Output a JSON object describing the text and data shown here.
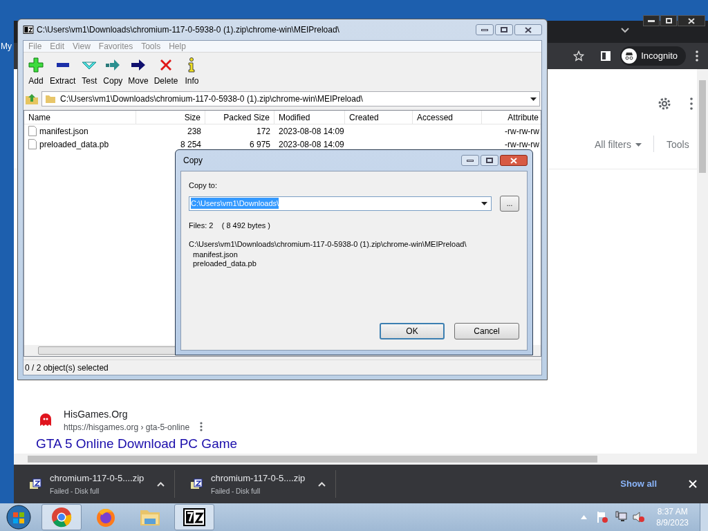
{
  "desktop": {
    "icon_label": "My"
  },
  "browser": {
    "profile": "Incognito",
    "filters": "All filters",
    "tools": "Tools",
    "result": {
      "site": "HisGames.Org",
      "url": "https://hisgames.org › gta-5-online",
      "title": "GTA 5 Online Download PC Game"
    },
    "downloads": [
      {
        "name": "chromium-117-0-5....zip",
        "status": "Failed - Disk full"
      },
      {
        "name": "chromium-117-0-5....zip",
        "status": "Failed - Disk full"
      }
    ],
    "show_all": "Show all"
  },
  "archive_window": {
    "title": "C:\\Users\\vm1\\Downloads\\chromium-117-0-5938-0 (1).zip\\chrome-win\\MEIPreload\\",
    "menu": [
      "File",
      "Edit",
      "View",
      "Favorites",
      "Tools",
      "Help"
    ],
    "toolbar": [
      {
        "label": "Add",
        "kind": "add"
      },
      {
        "label": "Extract",
        "kind": "extract"
      },
      {
        "label": "Test",
        "kind": "test"
      },
      {
        "label": "Copy",
        "kind": "copy"
      },
      {
        "label": "Move",
        "kind": "move"
      },
      {
        "label": "Delete",
        "kind": "delete"
      },
      {
        "label": "Info",
        "kind": "info"
      }
    ],
    "path": "C:\\Users\\vm1\\Downloads\\chromium-117-0-5938-0 (1).zip\\chrome-win\\MEIPreload\\",
    "columns": [
      "Name",
      "Size",
      "Packed Size",
      "Modified",
      "Created",
      "Accessed",
      "Attribute"
    ],
    "rows": [
      {
        "name": "manifest.json",
        "size": "238",
        "packed_size": "172",
        "modified": "2023-08-08 14:09",
        "attributes": "-rw-rw-rw",
        "selected": false
      },
      {
        "name": "preloaded_data.pb",
        "size": "8 254",
        "packed_size": "6 975",
        "modified": "2023-08-08 14:09",
        "attributes": "-rw-rw-rw",
        "selected": false
      }
    ],
    "status": "0 / 2 object(s) selected"
  },
  "copy_dialog": {
    "title": "Copy",
    "label": "Copy to:",
    "value": "C:\\Users\\vm1\\Downloads\\",
    "value_highlighted": true,
    "browse": "...",
    "summary": "Files: 2    ( 8 492 bytes )",
    "source": "C:\\Users\\vm1\\Downloads\\chromium-117-0-5938-0 (1).zip\\chrome-win\\MEIPreload\\",
    "files": [
      "manifest.json",
      "preloaded_data.pb"
    ],
    "buttons": [
      {
        "label": "OK",
        "default": true
      },
      {
        "label": "Cancel",
        "default": false
      }
    ]
  },
  "taskbar": {
    "apps": [
      {
        "kind": "chrome",
        "running": true
      },
      {
        "kind": "firefox",
        "running": false
      },
      {
        "kind": "explorer",
        "running": false
      },
      {
        "kind": "sevenzip",
        "running": true
      }
    ],
    "time": "8:37 AM",
    "date": "8/9/2023"
  }
}
